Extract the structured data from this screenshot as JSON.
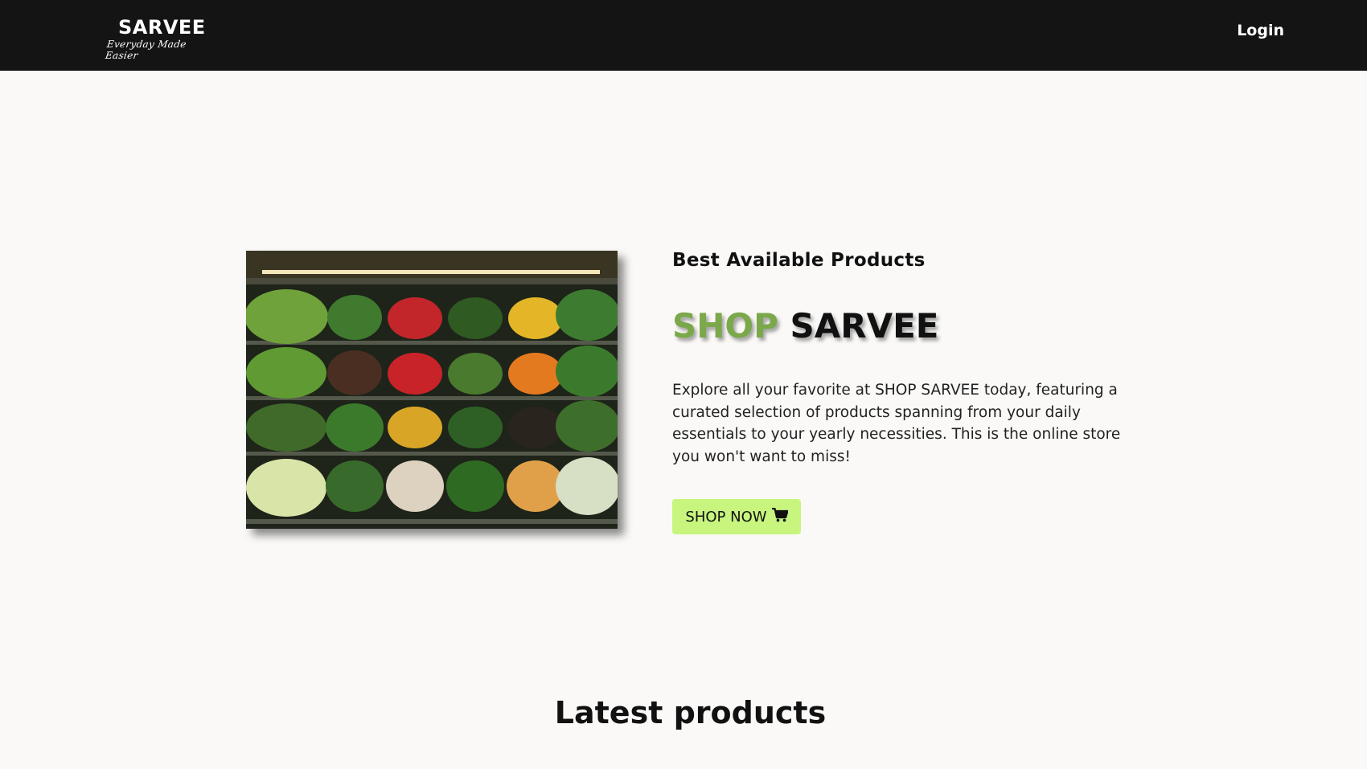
{
  "header": {
    "logo_word": "SARVEE",
    "logo_tagline": "Everyday Made Easier",
    "login_label": "Login"
  },
  "hero": {
    "image_alt": "Produce shelves with vegetables",
    "subtitle": "Best Available Products",
    "headline_part1": "SHOP",
    "headline_part2": "SARVEE",
    "description": "Explore all your favorite at SHOP SARVEE today, featuring a curated selection of products spanning from your daily essentials to your yearly necessities. This is the online store you won't want to miss!",
    "cta_label": "SHOP NOW",
    "cta_icon": "cart-icon"
  },
  "latest": {
    "title": "Latest products"
  },
  "colors": {
    "navbar_bg": "#141414",
    "page_bg": "#faf9f7",
    "accent_green": "#7aa84a",
    "button_bg": "#c7f57e"
  }
}
